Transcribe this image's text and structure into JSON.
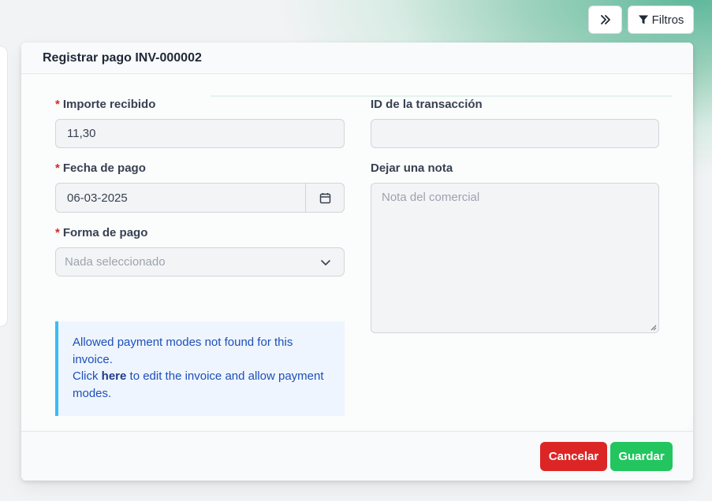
{
  "toolbar": {
    "expand_icon": "double-chevron-right-icon",
    "filters_label": "Filtros",
    "filter_icon": "funnel-icon"
  },
  "modal": {
    "title": "Registrar pago INV-000002",
    "fields": {
      "amount": {
        "required_mark": "*",
        "label": "Importe recibido",
        "value": "11,30"
      },
      "transaction_id": {
        "label": "ID de la transacción",
        "value": ""
      },
      "payment_date": {
        "required_mark": "*",
        "label": "Fecha de pago",
        "value": "06-03-2025",
        "icon": "calendar-icon"
      },
      "note": {
        "label": "Dejar una nota",
        "placeholder": "Nota del comercial"
      },
      "payment_mode": {
        "required_mark": "*",
        "label": "Forma de pago",
        "placeholder": "Nada seleccionado",
        "icon": "chevron-down-icon"
      }
    },
    "alert": {
      "line1": "Allowed payment modes not found for this invoice.",
      "click": "Click",
      "link": "here",
      "line2": "to edit the invoice and allow payment modes."
    },
    "buttons": {
      "cancel": "Cancelar",
      "save": "Guardar"
    }
  },
  "colors": {
    "cancel": "#dc2626",
    "save": "#22c55e",
    "required": "#dc2626",
    "alert_border": "#38bdf8",
    "alert_text": "#1e4fb8"
  }
}
